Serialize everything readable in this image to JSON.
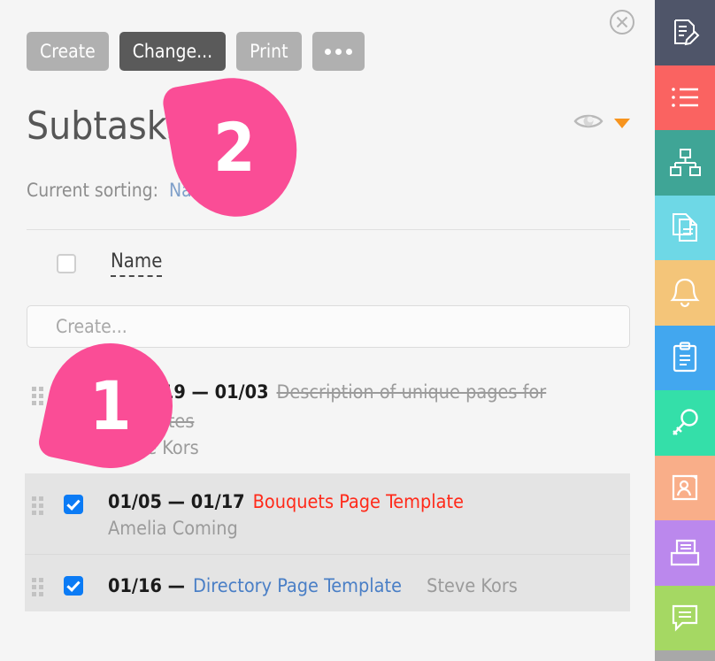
{
  "window": {
    "close_label": "×"
  },
  "toolbar": {
    "buttons": [
      {
        "label": "Create",
        "style": "light"
      },
      {
        "label": "Change...",
        "style": "dark"
      },
      {
        "label": "Print",
        "style": "light"
      },
      {
        "label": "•••",
        "style": "dots"
      }
    ]
  },
  "header": {
    "title": "Subtasks",
    "eye_icon": "eye-icon",
    "caret_icon": "caret-down-icon"
  },
  "sorting": {
    "label": "Current sorting:",
    "value": "Name"
  },
  "table": {
    "columns": {
      "select_all": "",
      "name": "Name"
    },
    "create_placeholder": "Create...",
    "create_value": "",
    "rows": [
      {
        "date": "12/2019 — 01/03",
        "name": "Description of unique pages for templates",
        "assignee": "Steve Kors",
        "checked": false,
        "state": "done",
        "color": "gray",
        "layout": "block",
        "shaded": false
      },
      {
        "date": "01/05 — 01/17",
        "name": "Bouquets Page Template",
        "assignee": "Amelia Coming",
        "checked": true,
        "state": "active",
        "color": "red",
        "layout": "block",
        "shaded": true
      },
      {
        "date": "01/16 —",
        "name": "Directory Page Template",
        "assignee": "Steve Kors",
        "checked": true,
        "state": "active",
        "color": "blue",
        "layout": "inline",
        "shaded": true
      }
    ]
  },
  "callouts": [
    {
      "number": "1"
    },
    {
      "number": "2"
    }
  ],
  "sidebar": {
    "items": [
      {
        "name": "sidebar-edit-document",
        "icon": "document-edit-icon",
        "color": "#4f5569"
      },
      {
        "name": "sidebar-task-list",
        "icon": "list-icon",
        "color": "#fa6361"
      },
      {
        "name": "sidebar-org-chart",
        "icon": "org-chart-icon",
        "color": "#3fa596"
      },
      {
        "name": "sidebar-documents",
        "icon": "copy-documents-icon",
        "color": "#6ed8e6"
      },
      {
        "name": "sidebar-notifications",
        "icon": "bell-icon",
        "color": "#f4c579"
      },
      {
        "name": "sidebar-clipboard",
        "icon": "clipboard-icon",
        "color": "#42a7ef"
      },
      {
        "name": "sidebar-access-keys",
        "icon": "key-icon",
        "color": "#34dfa9"
      },
      {
        "name": "sidebar-contacts",
        "icon": "contact-book-icon",
        "color": "#f9ae89"
      },
      {
        "name": "sidebar-archive",
        "icon": "file-archive-icon",
        "color": "#bb88ed"
      },
      {
        "name": "sidebar-chat",
        "icon": "chat-bubble-icon",
        "color": "#a5d863"
      }
    ],
    "footer_color": "#a8a8a8"
  },
  "colors": {
    "accent_pink": "#fa4d96",
    "checkbox_blue": "#0b7bf5",
    "caret_orange": "#f7941e",
    "task_red": "#ff2a1a",
    "task_blue": "#4a7fc6",
    "panel_bg": "#f5f5f5",
    "row_shade": "#e4e4e4"
  }
}
